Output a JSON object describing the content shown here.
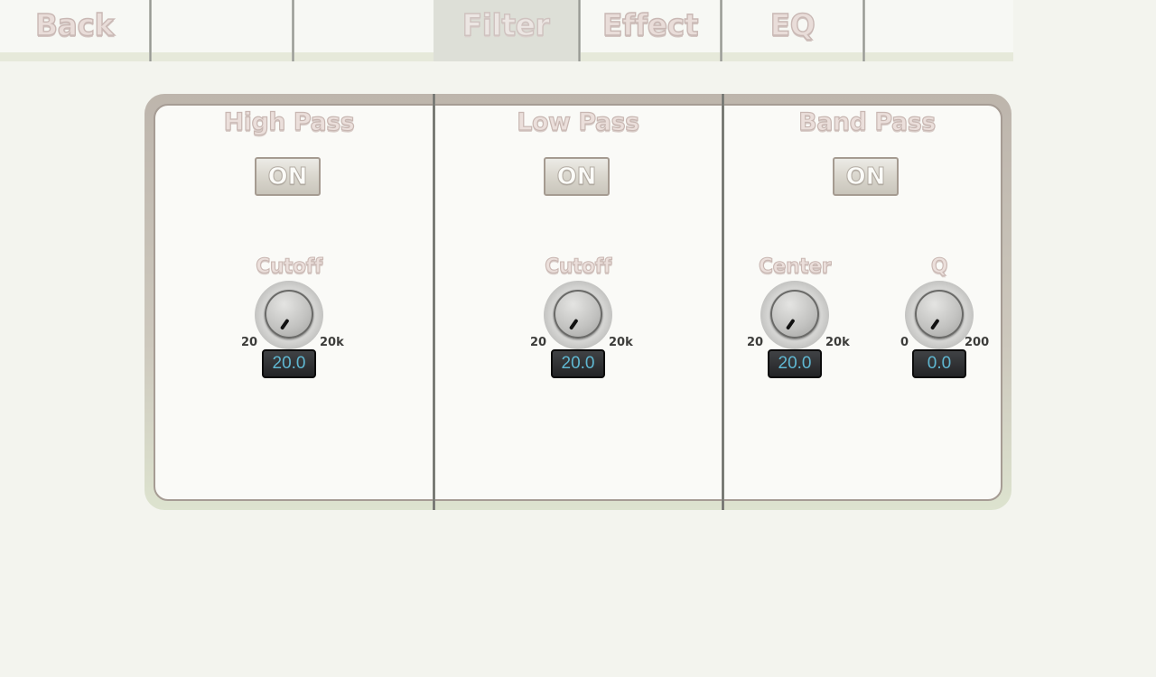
{
  "tabs": [
    {
      "label": "Back",
      "active": false
    },
    {
      "label": "",
      "active": false
    },
    {
      "label": "",
      "active": false
    },
    {
      "label": "Filter",
      "active": true
    },
    {
      "label": "Effect",
      "active": false
    },
    {
      "label": "EQ",
      "active": false
    },
    {
      "label": "",
      "active": false
    }
  ],
  "sections": [
    {
      "title": "High Pass",
      "toggle_label": "ON",
      "knobs": [
        {
          "label": "Cutoff",
          "min_label": "20",
          "max_label": "20k",
          "value": "20.0"
        }
      ]
    },
    {
      "title": "Low Pass",
      "toggle_label": "ON",
      "knobs": [
        {
          "label": "Cutoff",
          "min_label": "20",
          "max_label": "20k",
          "value": "20.0"
        }
      ]
    },
    {
      "title": "Band Pass",
      "toggle_label": "ON",
      "knobs": [
        {
          "label": "Center",
          "min_label": "20",
          "max_label": "20k",
          "value": "20.0"
        },
        {
          "label": "Q",
          "min_label": "0",
          "max_label": "200",
          "value": "0.0"
        }
      ]
    }
  ],
  "colors": {
    "background": "#f3f4ee",
    "value_text": "#5fb7d1",
    "active_tab": "#dddfd7"
  }
}
